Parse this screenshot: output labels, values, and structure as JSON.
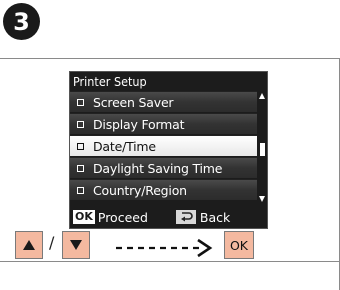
{
  "step": {
    "number": "3"
  },
  "lcd": {
    "title": "Printer Setup",
    "items": [
      {
        "label": "Screen Saver",
        "selected": false
      },
      {
        "label": "Display Format",
        "selected": false
      },
      {
        "label": "Date/Time",
        "selected": true
      },
      {
        "label": "Daylight Saving Time",
        "selected": false
      },
      {
        "label": "Country/Region",
        "selected": false
      }
    ],
    "footer": {
      "ok_chip": "OK",
      "proceed_label": "Proceed",
      "back_label": "Back"
    }
  },
  "keys": {
    "up_icon": "triangle-up",
    "down_icon": "triangle-down",
    "slash": "/",
    "ok_label": "OK"
  },
  "colors": {
    "key_fill": "#f4b9a0",
    "lcd_bg": "#1c1c1c",
    "badge": "#1a1a1a"
  }
}
